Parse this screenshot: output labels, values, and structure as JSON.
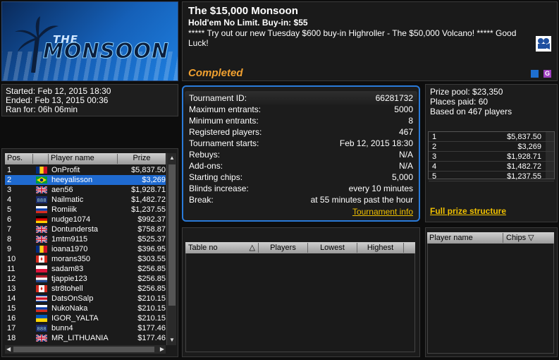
{
  "logo": {
    "the": "THE",
    "name": "MONSOON"
  },
  "header": {
    "title": "The $15,000 Monsoon",
    "subtitle": "Hold'em No Limit. Buy-in: $55",
    "promo": "***** Try out our new Tuesday $600 buy-in Highroller - The $50,000 Volcano! ***** Good Luck!",
    "status": "Completed"
  },
  "dates": {
    "started": "Started: Feb 12, 2015 18:30",
    "ended": "Ended: Feb 13, 2015 00:36",
    "ran_for": "Ran for: 06h 06min"
  },
  "players_table": {
    "columns": [
      "Pos.",
      "Player name",
      "Prize"
    ],
    "rows": [
      {
        "pos": "1",
        "name": "OnProfit",
        "prize": "$5,837.50",
        "flag": "romania"
      },
      {
        "pos": "2",
        "name": "heeyalisson",
        "prize": "$3,269",
        "flag": "brazil",
        "selected": true
      },
      {
        "pos": "3",
        "name": "aen56",
        "prize": "$1,928.71",
        "flag": "uk"
      },
      {
        "pos": "4",
        "name": "Nailmatic",
        "prize": "$1,482.72",
        "flag": "unknown"
      },
      {
        "pos": "5",
        "name": "Romiiik",
        "prize": "$1,237.55",
        "flag": "russia"
      },
      {
        "pos": "6",
        "name": "nudge1074",
        "prize": "$992.37",
        "flag": "germany"
      },
      {
        "pos": "7",
        "name": "Dontundersta",
        "prize": "$758.87",
        "flag": "uk"
      },
      {
        "pos": "8",
        "name": "1mtm9115",
        "prize": "$525.37",
        "flag": "uk"
      },
      {
        "pos": "9",
        "name": "ioana1970",
        "prize": "$396.95",
        "flag": "romania"
      },
      {
        "pos": "10",
        "name": "morans350",
        "prize": "$303.55",
        "flag": "canada"
      },
      {
        "pos": "11",
        "name": "sadam83",
        "prize": "$256.85",
        "flag": "poland"
      },
      {
        "pos": "12",
        "name": "tjappie123",
        "prize": "$256.85",
        "flag": "netherlands"
      },
      {
        "pos": "13",
        "name": "str8tohell",
        "prize": "$256.85",
        "flag": "canada"
      },
      {
        "pos": "14",
        "name": "DatsOnSalp",
        "prize": "$210.15",
        "flag": "costa-rica"
      },
      {
        "pos": "15",
        "name": "NukoNaka",
        "prize": "$210.15",
        "flag": "russia"
      },
      {
        "pos": "16",
        "name": "IGOR_YALTA",
        "prize": "$210.15",
        "flag": "ukraine"
      },
      {
        "pos": "17",
        "name": "bunn4",
        "prize": "$177.46",
        "flag": "unknown"
      },
      {
        "pos": "18",
        "name": "MR_LITHUANIA",
        "prize": "$177.46",
        "flag": "uk"
      }
    ]
  },
  "tournament_info": {
    "rows": [
      {
        "k": "Tournament ID:",
        "v": "66281732"
      },
      {
        "k": "Maximum entrants:",
        "v": "5000"
      },
      {
        "k": "Minimum entrants:",
        "v": "8"
      },
      {
        "k": "Registered players:",
        "v": "467"
      },
      {
        "k": "Tournament starts:",
        "v": "Feb 12, 2015 18:30"
      },
      {
        "k": "Rebuys:",
        "v": "N/A"
      },
      {
        "k": "Add-ons:",
        "v": "N/A"
      },
      {
        "k": "Starting chips:",
        "v": "5,000"
      },
      {
        "k": "Blinds increase:",
        "v": "every 10 minutes"
      },
      {
        "k": "Break:",
        "v": "at 55 minutes past the hour"
      }
    ],
    "link": "Tournament info"
  },
  "prize_pool": {
    "pool": "Prize pool: $23,350",
    "places": "Places paid: 60",
    "based": "Based on 467 players",
    "rows": [
      {
        "place": "1",
        "amount": "$5,837.50"
      },
      {
        "place": "2",
        "amount": "$3,269"
      },
      {
        "place": "3",
        "amount": "$1,928.71"
      },
      {
        "place": "4",
        "amount": "$1,482.72"
      },
      {
        "place": "5",
        "amount": "$1,237.55"
      }
    ],
    "link": "Full prize structure"
  },
  "tables_list": {
    "columns": [
      "Table no",
      "Players",
      "Lowest",
      "Highest"
    ]
  },
  "chips_list": {
    "columns": [
      "Player name",
      "Chips"
    ]
  },
  "colors": {
    "accent": "#2a7ad8",
    "link": "#f0c000",
    "status": "#f0a030",
    "selected_row": "#1f6ad0"
  }
}
